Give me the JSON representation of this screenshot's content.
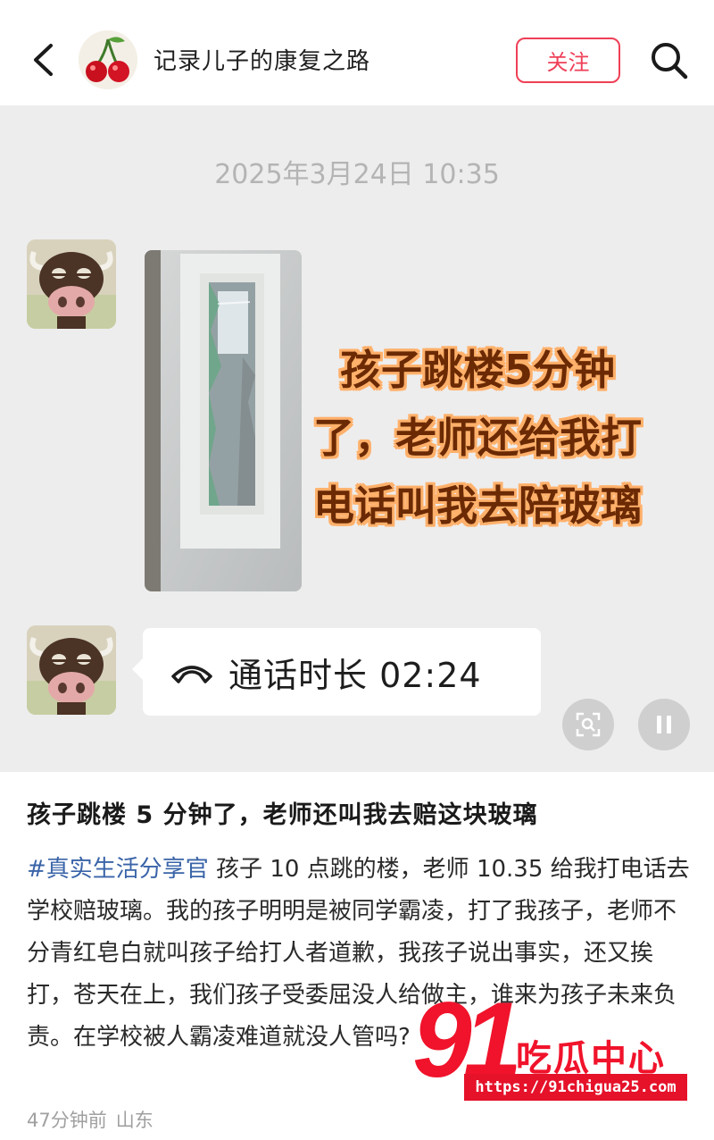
{
  "header": {
    "account_name": "记录儿子的康复之路",
    "follow_label": "关注"
  },
  "media": {
    "chat_time": "2025年3月24日 10:35",
    "overlay_lines": [
      "孩子跳楼5分钟",
      "了，老师还给我打",
      "电话叫我去陪玻璃"
    ],
    "call_text": "通话时长 02:24"
  },
  "post": {
    "title": "孩子跳楼 5 分钟了，老师还叫我去赔这块玻璃",
    "hashtag": "#真实生活分享官",
    "body": " 孩子 10 点跳的楼，老师 10.35 给我打电话去学校赔玻璃。我的孩子明明是被同学霸凌，打了我孩子，老师不分青红皂白就叫孩子给打人者道歉，我孩子说出事实，还又挨打，苍天在上，我们孩子受委屈没人给做主，谁来为孩子未来负责。在学校被人霸凌难道就没人管吗?",
    "time_ago": "47分钟前",
    "location": "山东"
  },
  "watermark": {
    "number": "91",
    "name": "吃瓜中心",
    "url": "https://91chigua25.com"
  },
  "colors": {
    "accent": "#ef3f57",
    "hashtag": "#3a64a8",
    "overlay_text": "#6b2a04",
    "overlay_outline": "#ffb06a",
    "watermark": "#f0132b"
  },
  "icons": [
    "back-arrow-icon",
    "cherry-avatar",
    "search-icon",
    "cow-avatar",
    "phone-hangup-icon",
    "scan-icon",
    "pause-icon"
  ]
}
